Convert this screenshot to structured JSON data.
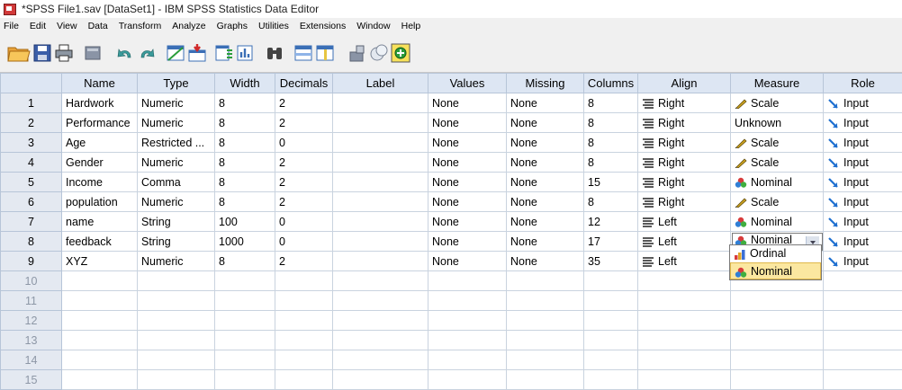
{
  "window": {
    "title": "*SPSS File1.sav [DataSet1] - IBM SPSS Statistics Data Editor"
  },
  "menu": [
    "File",
    "Edit",
    "View",
    "Data",
    "Transform",
    "Analyze",
    "Graphs",
    "Utilities",
    "Extensions",
    "Window",
    "Help"
  ],
  "toolbar": {
    "icons": [
      "open-folder-icon",
      "save-icon",
      "print-icon",
      "dialog-recall-icon",
      "undo-icon",
      "redo-icon",
      "goto-case-icon",
      "goto-variable-icon",
      "variables-icon",
      "run-descriptive-icon",
      "find-icon",
      "insert-cases-icon",
      "insert-variable-icon",
      "split-file-icon",
      "select-cases-icon",
      "spelling-icon"
    ]
  },
  "grid": {
    "headers": [
      "",
      "Name",
      "Type",
      "Width",
      "Decimals",
      "Label",
      "Values",
      "Missing",
      "Columns",
      "Align",
      "Measure",
      "Role"
    ],
    "rows": [
      {
        "num": "1",
        "name": "Hardwork",
        "type": "Numeric",
        "width": "8",
        "decimals": "2",
        "label": "",
        "values": "None",
        "missing": "None",
        "columns": "8",
        "align": "Right",
        "measure": "Scale",
        "role": "Input"
      },
      {
        "num": "2",
        "name": "Performance",
        "type": "Numeric",
        "width": "8",
        "decimals": "2",
        "label": "",
        "values": "None",
        "missing": "None",
        "columns": "8",
        "align": "Right",
        "measure": "Unknown",
        "role": "Input"
      },
      {
        "num": "3",
        "name": "Age",
        "type": "Restricted ...",
        "width": "8",
        "decimals": "0",
        "label": "",
        "values": "None",
        "missing": "None",
        "columns": "8",
        "align": "Right",
        "measure": "Scale",
        "role": "Input"
      },
      {
        "num": "4",
        "name": "Gender",
        "type": "Numeric",
        "width": "8",
        "decimals": "2",
        "label": "",
        "values": "None",
        "missing": "None",
        "columns": "8",
        "align": "Right",
        "measure": "Scale",
        "role": "Input"
      },
      {
        "num": "5",
        "name": "Income",
        "type": "Comma",
        "width": "8",
        "decimals": "2",
        "label": "",
        "values": "None",
        "missing": "None",
        "columns": "15",
        "align": "Right",
        "measure": "Nominal",
        "role": "Input"
      },
      {
        "num": "6",
        "name": "population",
        "type": "Numeric",
        "width": "8",
        "decimals": "2",
        "label": "",
        "values": "None",
        "missing": "None",
        "columns": "8",
        "align": "Right",
        "measure": "Scale",
        "role": "Input"
      },
      {
        "num": "7",
        "name": "name",
        "type": "String",
        "width": "100",
        "decimals": "0",
        "label": "",
        "values": "None",
        "missing": "None",
        "columns": "12",
        "align": "Left",
        "measure": "Nominal",
        "role": "Input"
      },
      {
        "num": "8",
        "name": "feedback",
        "type": "String",
        "width": "1000",
        "decimals": "0",
        "label": "",
        "values": "None",
        "missing": "None",
        "columns": "17",
        "align": "Left",
        "measure": "Nominal",
        "role": "Input"
      },
      {
        "num": "9",
        "name": "XYZ",
        "type": "Numeric",
        "width": "8",
        "decimals": "2",
        "label": "",
        "values": "None",
        "missing": "None",
        "columns": "35",
        "align": "Left",
        "measure": "",
        "role": "Input"
      }
    ],
    "empty_rows": [
      "10",
      "11",
      "12",
      "13",
      "14",
      "15"
    ]
  },
  "measure_dropdown": {
    "options": [
      "Ordinal",
      "Nominal"
    ],
    "selected": "Nominal"
  },
  "colors": {
    "header_bg": "#dde6f3",
    "rownum_bg": "#e4e9f1",
    "grid_line": "#c9d3df",
    "role_arrow": "#1e6fd0",
    "scale_icon": "#c8a020",
    "highlight": "#fbe7a0"
  }
}
